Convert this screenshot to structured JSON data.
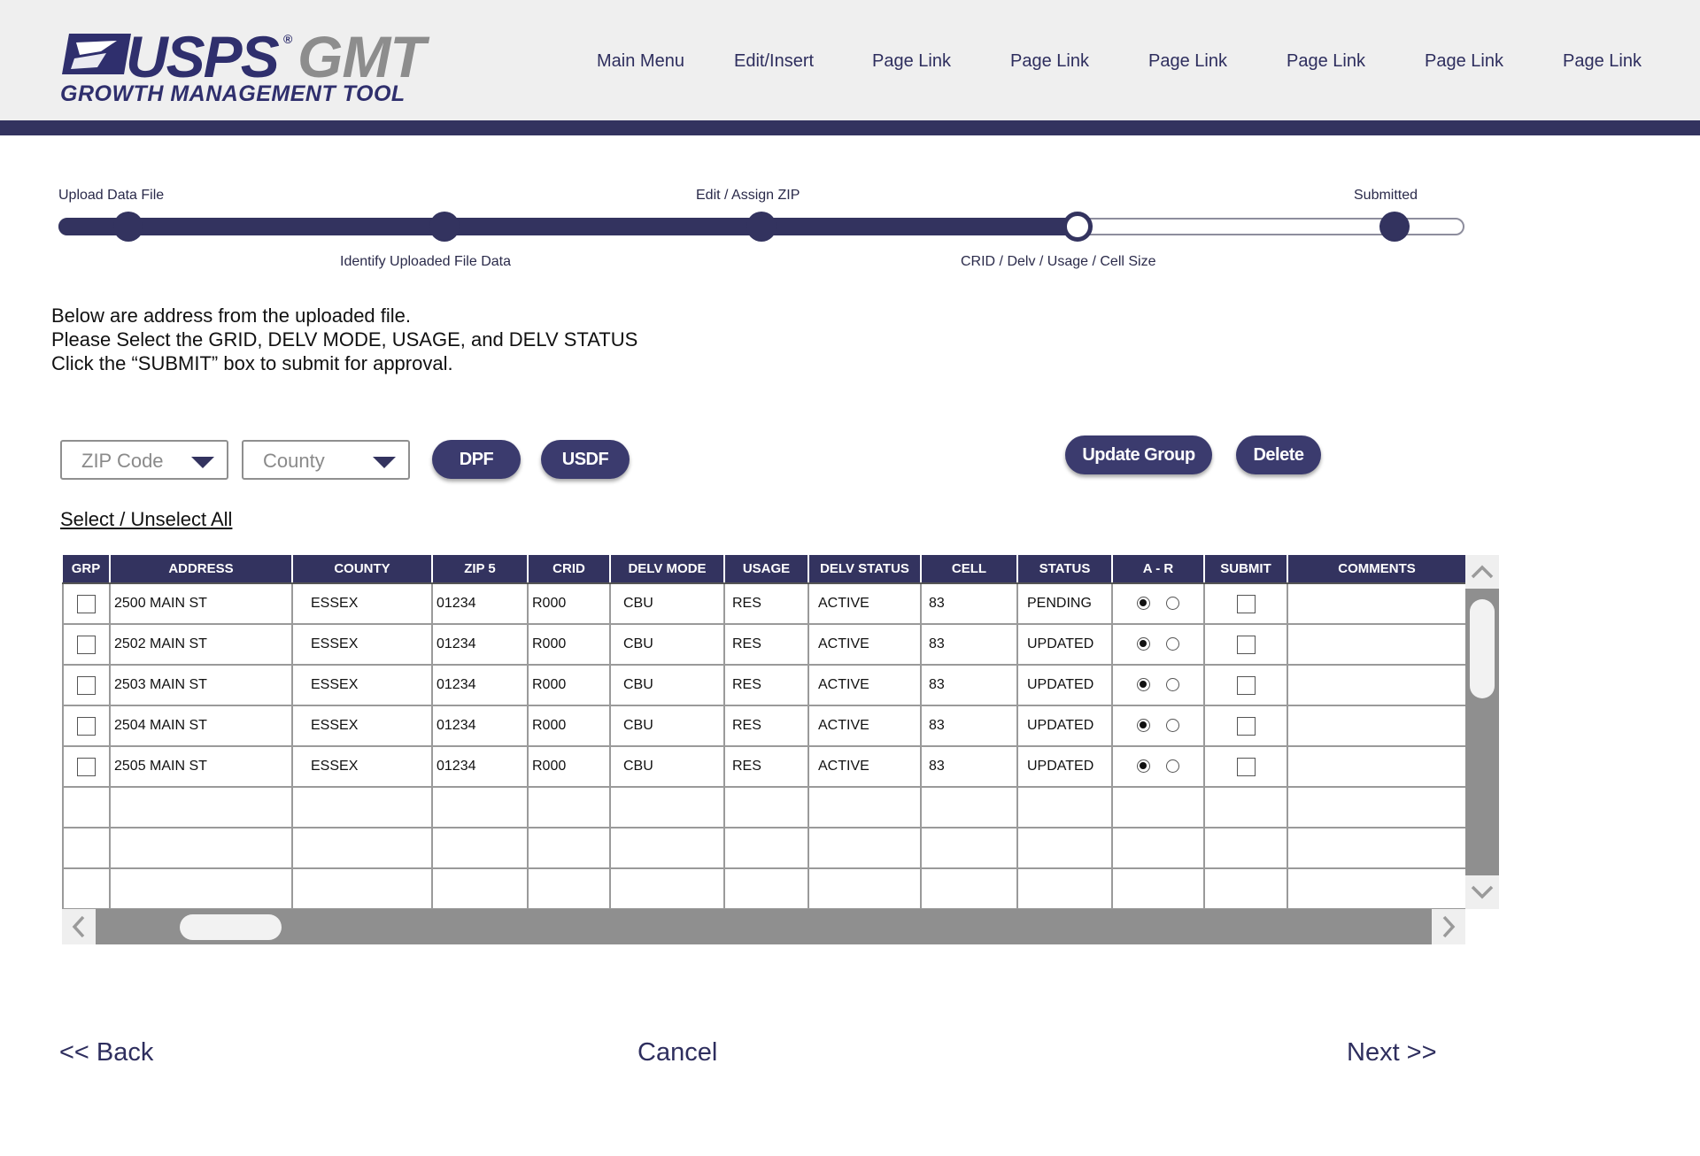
{
  "header": {
    "logo": {
      "brand": "USPS",
      "reg": "®",
      "product": "GMT",
      "subtitle": "GROWTH MANAGEMENT TOOL"
    },
    "nav": [
      "Main Menu",
      "Edit/Insert",
      "Page Link",
      "Page Link",
      "Page Link",
      "Page Link",
      "Page Link",
      "Page Link"
    ]
  },
  "progress": {
    "steps": [
      "Upload Data File",
      "Identify Uploaded File Data",
      "Edit / Assign ZIP",
      "CRID / Delv / Usage / Cell Size",
      "Submitted"
    ],
    "current_step": 4
  },
  "instructions": [
    "Below are address from the uploaded file.",
    "Please Select the GRID, DELV MODE, USAGE, and DELV STATUS",
    "Click the “SUBMIT” box to submit for approval."
  ],
  "filters": {
    "zip_placeholder": "ZIP Code",
    "county_placeholder": "County"
  },
  "buttons": {
    "dpf": "DPF",
    "usdf": "USDF",
    "update_group": "Update Group",
    "delete": "Delete"
  },
  "select_all": "Select / Unselect All",
  "table": {
    "headers": [
      "GRP",
      "ADDRESS",
      "COUNTY",
      "ZIP 5",
      "CRID",
      "DELV MODE",
      "USAGE",
      "DELV STATUS",
      "CELL",
      "STATUS",
      "A - R",
      "SUBMIT",
      "COMMENTS"
    ],
    "rows": [
      {
        "address": "2500 MAIN ST",
        "county": "ESSEX",
        "zip5": "01234",
        "crid": "R000",
        "delv_mode": "CBU",
        "usage": "RES",
        "delv_status": "ACTIVE",
        "cell": "83",
        "status": "PENDING",
        "ar": "A"
      },
      {
        "address": "2502 MAIN ST",
        "county": "ESSEX",
        "zip5": "01234",
        "crid": "R000",
        "delv_mode": "CBU",
        "usage": "RES",
        "delv_status": "ACTIVE",
        "cell": "83",
        "status": "UPDATED",
        "ar": "A"
      },
      {
        "address": "2503 MAIN ST",
        "county": "ESSEX",
        "zip5": "01234",
        "crid": "R000",
        "delv_mode": "CBU",
        "usage": "RES",
        "delv_status": "ACTIVE",
        "cell": "83",
        "status": "UPDATED",
        "ar": "A"
      },
      {
        "address": "2504 MAIN ST",
        "county": "ESSEX",
        "zip5": "01234",
        "crid": "R000",
        "delv_mode": "CBU",
        "usage": "RES",
        "delv_status": "ACTIVE",
        "cell": "83",
        "status": "UPDATED",
        "ar": "A"
      },
      {
        "address": "2505 MAIN ST",
        "county": "ESSEX",
        "zip5": "01234",
        "crid": "R000",
        "delv_mode": "CBU",
        "usage": "RES",
        "delv_status": "ACTIVE",
        "cell": "83",
        "status": "UPDATED",
        "ar": "A"
      }
    ],
    "empty_rows": 3
  },
  "footer": {
    "back": "<< Back",
    "cancel": "Cancel",
    "next": "Next >>"
  },
  "colors": {
    "brand_navy": "#33335f",
    "status_green": "#2a9a2a",
    "header_bg": "#efefef",
    "logo_gray": "#8d8d8d"
  },
  "icons": [
    "eagle-logo-icon",
    "chevron-down-icon",
    "chevron-up-icon",
    "chevron-left-icon",
    "chevron-right-icon"
  ]
}
